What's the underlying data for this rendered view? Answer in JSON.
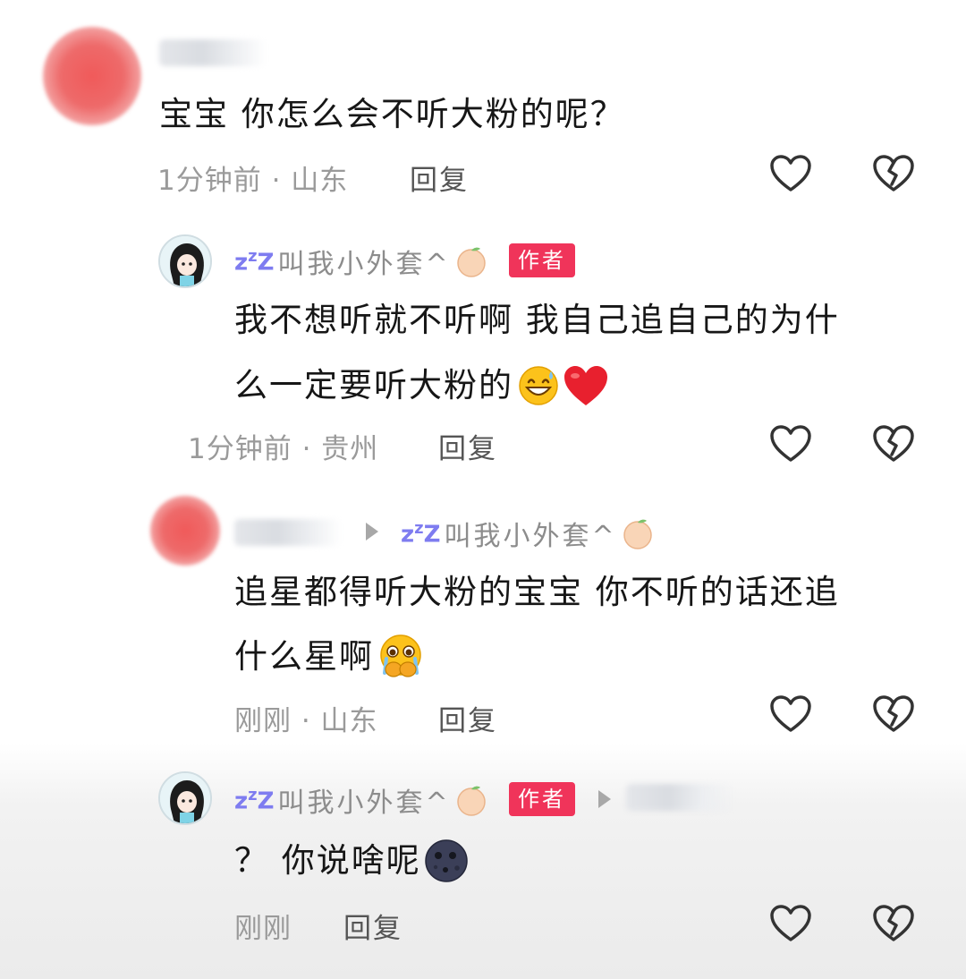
{
  "comments": [
    {
      "text": "宝宝 你怎么会不听大粉的呢？",
      "meta": "1分钟前 · 山东",
      "reply": "回复"
    },
    {
      "username": "叫我小外套^",
      "badge": "作者",
      "text_line1": "我不想听就不听啊 我自己追自己的为什",
      "text_line2": "么一定要听大粉的",
      "meta": "1分钟前 · 贵州",
      "reply": "回复"
    },
    {
      "reply_to": "叫我小外套^",
      "text_line1": "追星都得听大粉的宝宝 你不听的话还追",
      "text_line2": "什么星啊",
      "meta": "刚刚 · 山东",
      "reply": "回复"
    },
    {
      "username": "叫我小外套^",
      "badge": "作者",
      "text": "？ 你说啥呢",
      "meta": "刚刚",
      "reply": "回复"
    }
  ],
  "icons": [
    "heart-outline-icon",
    "broken-heart-icon",
    "peach-icon",
    "grin-sweat-emoji",
    "red-heart-emoji",
    "pleading-hands-emoji",
    "new-moon-face-emoji",
    "sleep-zz-icon"
  ],
  "colors": {
    "badge": "#f0345a",
    "meta": "#9a9a9a",
    "zz": "#7e7cf0",
    "heart_red": "#e8202e"
  }
}
